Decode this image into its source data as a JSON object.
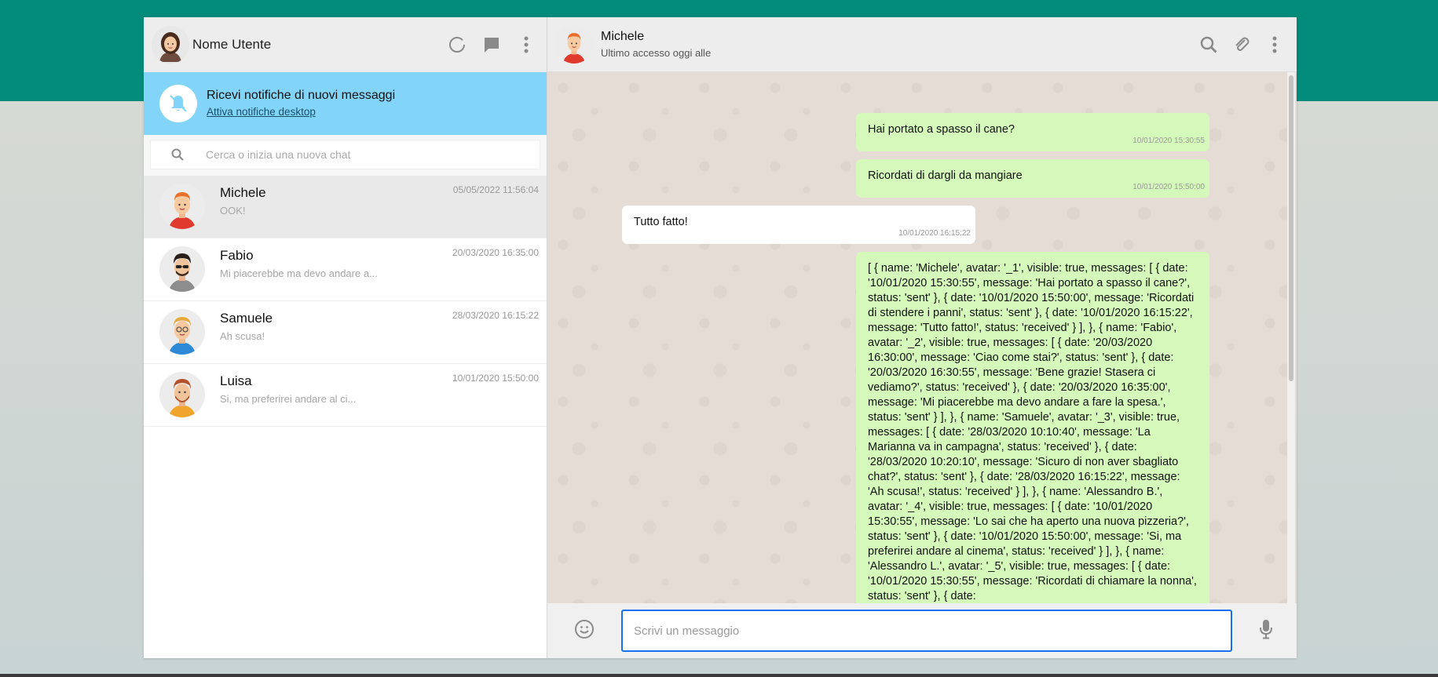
{
  "sidebar": {
    "user_name": "Nome Utente",
    "icons": [
      "status-icon",
      "chat-icon",
      "menu-icon"
    ],
    "notification": {
      "title": "Ricevi notifiche di nuovi messaggi",
      "link": "Attiva notifiche desktop"
    },
    "search": {
      "placeholder": "Cerca o inizia una nuova chat"
    },
    "contacts": [
      {
        "name": "Michele",
        "last": "OOK!",
        "date": "05/05/2022 11:56:04",
        "active": true
      },
      {
        "name": "Fabio",
        "last": "Mi piacerebbe ma devo andare a...",
        "date": "20/03/2020 16:35:00",
        "active": false
      },
      {
        "name": "Samuele",
        "last": "Ah scusa!",
        "date": "28/03/2020 16:15:22",
        "active": false
      },
      {
        "name": "Luisa",
        "last": "Si, ma preferirei andare al ci...",
        "date": "10/01/2020 15:50:00",
        "active": false
      }
    ]
  },
  "chat": {
    "name": "Michele",
    "subtitle": "Ultimo accesso oggi alle",
    "messages": [
      {
        "text": "Hai portato a spasso il cane?",
        "time": "10/01/2020 15:30:55",
        "status": "sent"
      },
      {
        "text": "Ricordati di dargli da mangiare",
        "time": "10/01/2020 15:50:00",
        "status": "sent"
      },
      {
        "text": "Tutto fatto!",
        "time": "10/01/2020 16:15:22",
        "status": "received"
      },
      {
        "text": "[ { name: 'Michele', avatar: '_1', visible: true, messages: [ { date: '10/01/2020 15:30:55', message: 'Hai portato a spasso il cane?', status: 'sent' }, { date: '10/01/2020 15:50:00', message: 'Ricordati di stendere i panni', status: 'sent' }, { date: '10/01/2020 16:15:22', message: 'Tutto fatto!', status: 'received' } ], }, { name: 'Fabio', avatar: '_2', visible: true, messages: [ { date: '20/03/2020 16:30:00', message: 'Ciao come stai?', status: 'sent' }, { date: '20/03/2020 16:30:55', message: 'Bene grazie! Stasera ci vediamo?', status: 'received' }, { date: '20/03/2020 16:35:00', message: 'Mi piacerebbe ma devo andare a fare la spesa.', status: 'sent' } ], }, { name: 'Samuele', avatar: '_3', visible: true, messages: [ { date: '28/03/2020 10:10:40', message: 'La Marianna va in campagna', status: 'received' }, { date: '28/03/2020 10:20:10', message: 'Sicuro di non aver sbagliato chat?', status: 'sent' }, { date: '28/03/2020 16:15:22', message: 'Ah scusa!', status: 'received' } ], }, { name: 'Alessandro B.', avatar: '_4', visible: true, messages: [ { date: '10/01/2020 15:30:55', message: 'Lo sai che ha aperto una nuova pizzeria?', status: 'sent' }, { date: '10/01/2020 15:50:00', message: 'Si, ma preferirei andare al cinema', status: 'received' } ], }, { name: 'Alessandro L.', avatar: '_5', visible: true, messages: [ { date: '10/01/2020 15:30:55', message: 'Ricordati di chiamare la nonna', status: 'sent' }, { date:",
        "time": "",
        "status": "sent"
      }
    ],
    "icons": [
      "search-icon",
      "attach-icon",
      "menu-icon"
    ]
  },
  "composer": {
    "placeholder": "Scrivi un messaggio",
    "icons": [
      "emoji-icon",
      "microphone-icon"
    ]
  },
  "colors": {
    "brand": "#008b7a",
    "notification_bg": "#82d5f8",
    "sent_bubble": "#d5f9ba",
    "received_bubble": "#ffffff",
    "input_border": "#1a6ff2"
  }
}
